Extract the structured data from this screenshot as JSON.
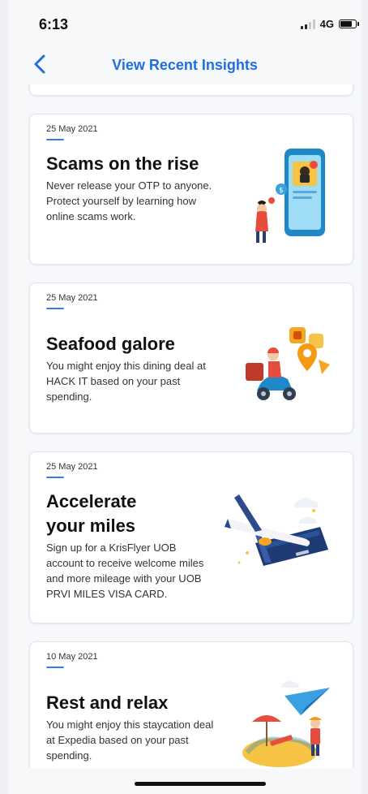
{
  "status_bar": {
    "time": "6:13",
    "network": "4G"
  },
  "header": {
    "title": "View Recent Insights",
    "back_icon": "chevron-left-icon"
  },
  "colors": {
    "accent": "#2f7df3",
    "title_blue": "#1f6fe0"
  },
  "insights": [
    {
      "date": "25 May 2021",
      "title": "Scams on the rise",
      "body": "Never release your OTP to anyone. Protect yourself by learning how online scams work.",
      "illustration": "phone-scam-illustration"
    },
    {
      "date": "25 May 2021",
      "title": "Seafood galore",
      "body": "You might enjoy this dining deal at HACK IT based on your past spending.",
      "illustration": "food-delivery-illustration"
    },
    {
      "date": "25 May 2021",
      "title": "Accelerate your miles",
      "body": "Sign up for a KrisFlyer UOB account to receive welcome miles and more mileage with your UOB PRVI MILES VISA CARD.",
      "illustration": "airplane-card-illustration"
    },
    {
      "date": "10 May 2021",
      "title": "Rest and relax",
      "body": "You might enjoy this staycation deal at Expedia based on your past spending.",
      "illustration": "beach-vacation-illustration"
    }
  ]
}
